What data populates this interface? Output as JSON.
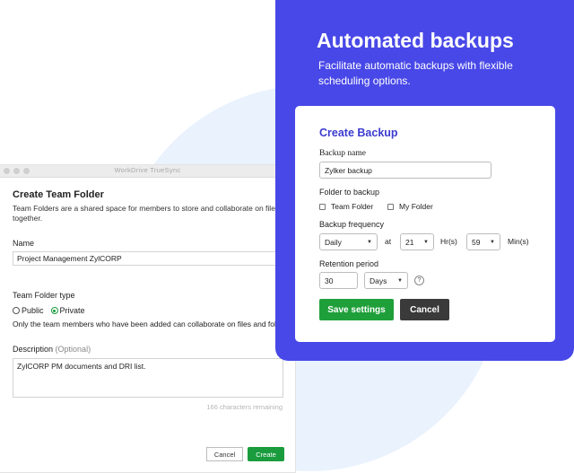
{
  "window": {
    "title": "WorkDrive TrueSync",
    "heading": "Create Team Folder",
    "subtext": "Team Folders are a shared space for members to store and collaborate on files together.",
    "name_label": "Name",
    "name_value": "Project Management ZylCORP",
    "type_label": "Team Folder type",
    "type_options": [
      "Public",
      "Private"
    ],
    "type_selected": "Private",
    "type_note": "Only the team members who have been added can collaborate on files and folders",
    "description_label": "Description",
    "description_optional": "(Optional)",
    "description_value": "ZylCORP PM documents and DRI list.",
    "chars_remaining": "166 characters remaining",
    "cancel_label": "Cancel",
    "create_label": "Create"
  },
  "promo": {
    "title": "Automated backups",
    "subtitle": "Facilitate automatic backups with flexible scheduling options.",
    "accent_color": "#4848e8"
  },
  "backup": {
    "title": "Create Backup",
    "name_label": "Backup name",
    "name_value": "Zylker backup",
    "folder_label": "Folder to backup",
    "folder_options": [
      "Team Folder",
      "My Folder"
    ],
    "frequency_label": "Backup frequency",
    "frequency_value": "Daily",
    "at_label": "at",
    "hour_value": "21",
    "hour_unit": "Hr(s)",
    "minute_value": "59",
    "minute_unit": "Min(s)",
    "retention_label": "Retention period",
    "retention_value": "30",
    "retention_unit": "Days",
    "help_glyph": "?",
    "save_label": "Save settings",
    "cancel_label": "Cancel"
  }
}
